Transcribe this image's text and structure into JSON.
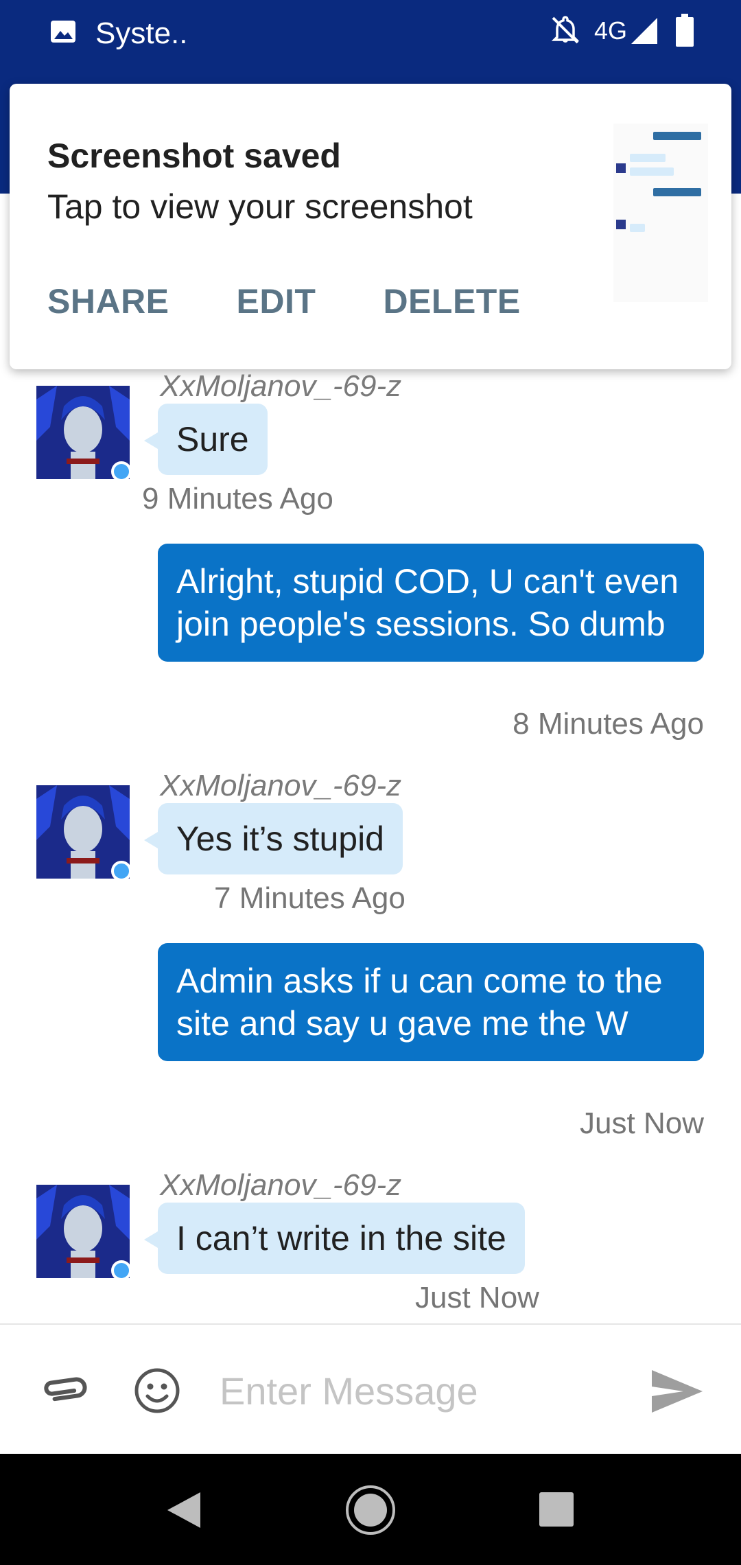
{
  "status_bar": {
    "title": "Syste..",
    "network": "4G",
    "icons": [
      "image-icon",
      "bell-off-icon",
      "signal-icon",
      "battery-icon"
    ],
    "background": "#0a2a7f"
  },
  "notification": {
    "title": "Screenshot saved",
    "subtitle": "Tap to view your screenshot",
    "actions": [
      "SHARE",
      "EDIT",
      "DELETE"
    ],
    "action_color": "#5a7486"
  },
  "messages": [
    {
      "direction": "incoming",
      "sender": "XxMoljanov_-69-z",
      "text": "Sure",
      "time": "9 Minutes Ago"
    },
    {
      "direction": "outgoing",
      "text": "Alright, stupid COD, U can't even join people's sessions. So dumb",
      "time": "8 Minutes Ago"
    },
    {
      "direction": "incoming",
      "sender": "XxMoljanov_-69-z",
      "text": "Yes it’s stupid",
      "time": "7 Minutes Ago"
    },
    {
      "direction": "outgoing",
      "text": "Admin asks if u can come to the site and say u gave me the W",
      "time": "Just Now"
    },
    {
      "direction": "incoming",
      "sender": "XxMoljanov_-69-z",
      "text": "I can’t write in the site",
      "time": "Just Now"
    }
  ],
  "composer": {
    "placeholder": "Enter Message",
    "icons": [
      "paperclip-icon",
      "emoji-icon",
      "send-icon"
    ]
  },
  "nav_bar": {
    "icons": [
      "back-icon",
      "home-icon",
      "recents-icon"
    ]
  },
  "colors": {
    "incoming_bubble": "#d6ebfa",
    "outgoing_bubble": "#0a73c7",
    "online_dot": "#42a5f5"
  }
}
